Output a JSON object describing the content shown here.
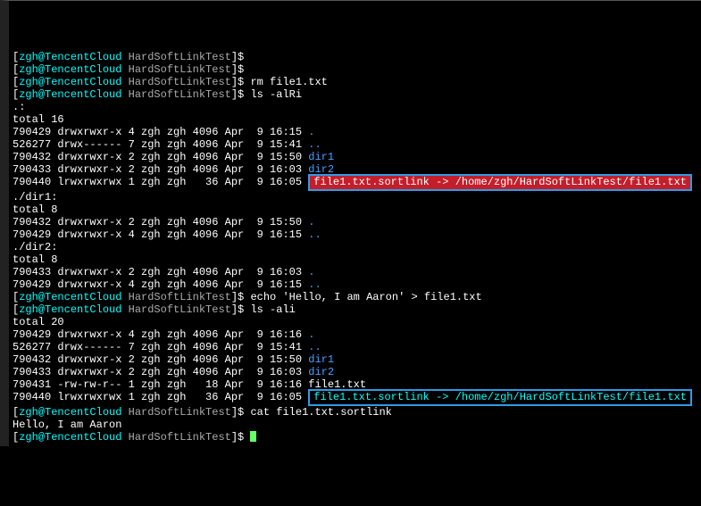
{
  "prompts": [
    {
      "user": "zgh@TencentCloud",
      "dir": "HardSoftLinkTest",
      "cmd": ""
    },
    {
      "user": "zgh@TencentCloud",
      "dir": "HardSoftLinkTest",
      "cmd": ""
    },
    {
      "user": "zgh@TencentCloud",
      "dir": "HardSoftLinkTest",
      "cmd": "rm file1.txt"
    },
    {
      "user": "zgh@TencentCloud",
      "dir": "HardSoftLinkTest",
      "cmd": "ls -alRi"
    }
  ],
  "block1_header": ".:",
  "block1_total": "total 16",
  "block1_rows": [
    {
      "inode": "790429",
      "perm": "drwxrwxr-x",
      "links": "4",
      "own": "zgh",
      "grp": "zgh",
      "size": "4096",
      "date": "Apr  9 16:15",
      "name": ".",
      "class": "blue"
    },
    {
      "inode": "526277",
      "perm": "drwx------",
      "links": "7",
      "own": "zgh",
      "grp": "zgh",
      "size": "4096",
      "date": "Apr  9 15:41",
      "name": "..",
      "class": "blue"
    },
    {
      "inode": "790432",
      "perm": "drwxrwxr-x",
      "links": "2",
      "own": "zgh",
      "grp": "zgh",
      "size": "4096",
      "date": "Apr  9 15:50",
      "name": "dir1",
      "class": "blue"
    },
    {
      "inode": "790433",
      "perm": "drwxrwxr-x",
      "links": "2",
      "own": "zgh",
      "grp": "zgh",
      "size": "4096",
      "date": "Apr  9 16:03",
      "name": "dir2",
      "class": "blue"
    }
  ],
  "symlink1_row": {
    "inode": "790440",
    "perm": "lrwxrwxrwx",
    "links": "1",
    "own": "zgh",
    "grp": "zgh",
    "size": "  36",
    "date": "Apr  9 16:05"
  },
  "symlink1_text": "file1.txt.sortlink -> /home/zgh/HardSoftLinkTest/file1.txt",
  "dir1_header": "./dir1:",
  "dir1_total": "total 8",
  "dir1_rows": [
    {
      "inode": "790432",
      "perm": "drwxrwxr-x",
      "links": "2",
      "own": "zgh",
      "grp": "zgh",
      "size": "4096",
      "date": "Apr  9 15:50",
      "name": ".",
      "class": "blue"
    },
    {
      "inode": "790429",
      "perm": "drwxrwxr-x",
      "links": "4",
      "own": "zgh",
      "grp": "zgh",
      "size": "4096",
      "date": "Apr  9 16:15",
      "name": "..",
      "class": "blue"
    }
  ],
  "dir2_header": "./dir2:",
  "dir2_total": "total 8",
  "dir2_rows": [
    {
      "inode": "790433",
      "perm": "drwxrwxr-x",
      "links": "2",
      "own": "zgh",
      "grp": "zgh",
      "size": "4096",
      "date": "Apr  9 16:03",
      "name": ".",
      "class": "blue"
    },
    {
      "inode": "790429",
      "perm": "drwxrwxr-x",
      "links": "4",
      "own": "zgh",
      "grp": "zgh",
      "size": "4096",
      "date": "Apr  9 16:15",
      "name": "..",
      "class": "blue"
    }
  ],
  "prompts2": [
    {
      "user": "zgh@TencentCloud",
      "dir": "HardSoftLinkTest",
      "cmd": "echo 'Hello, I am Aaron' > file1.txt"
    },
    {
      "user": "zgh@TencentCloud",
      "dir": "HardSoftLinkTest",
      "cmd": "ls -ali"
    }
  ],
  "block2_total": "total 20",
  "block2_rows": [
    {
      "inode": "790429",
      "perm": "drwxrwxr-x",
      "links": "4",
      "own": "zgh",
      "grp": "zgh",
      "size": "4096",
      "date": "Apr  9 16:16",
      "name": ".",
      "class": "blue"
    },
    {
      "inode": "526277",
      "perm": "drwx------",
      "links": "7",
      "own": "zgh",
      "grp": "zgh",
      "size": "4096",
      "date": "Apr  9 15:41",
      "name": "..",
      "class": "blue"
    },
    {
      "inode": "790432",
      "perm": "drwxrwxr-x",
      "links": "2",
      "own": "zgh",
      "grp": "zgh",
      "size": "4096",
      "date": "Apr  9 15:50",
      "name": "dir1",
      "class": "blue"
    },
    {
      "inode": "790433",
      "perm": "drwxrwxr-x",
      "links": "2",
      "own": "zgh",
      "grp": "zgh",
      "size": "4096",
      "date": "Apr  9 16:03",
      "name": "dir2",
      "class": "blue"
    },
    {
      "inode": "790431",
      "perm": "-rw-rw-r--",
      "links": "1",
      "own": "zgh",
      "grp": "zgh",
      "size": "  18",
      "date": "Apr  9 16:16",
      "name": "file1.txt",
      "class": "white"
    }
  ],
  "symlink2_row": {
    "inode": "790440",
    "perm": "lrwxrwxrwx",
    "links": "1",
    "own": "zgh",
    "grp": "zgh",
    "size": "  36",
    "date": "Apr  9 16:05"
  },
  "symlink2_text": "file1.txt.sortlink -> /home/zgh/HardSoftLinkTest/file1.txt",
  "prompts3": [
    {
      "user": "zgh@TencentCloud",
      "dir": "HardSoftLinkTest",
      "cmd": "cat file1.txt.sortlink"
    }
  ],
  "cat_output": "Hello, I am Aaron",
  "final_prompt": {
    "user": "zgh@TencentCloud",
    "dir": "HardSoftLinkTest"
  }
}
